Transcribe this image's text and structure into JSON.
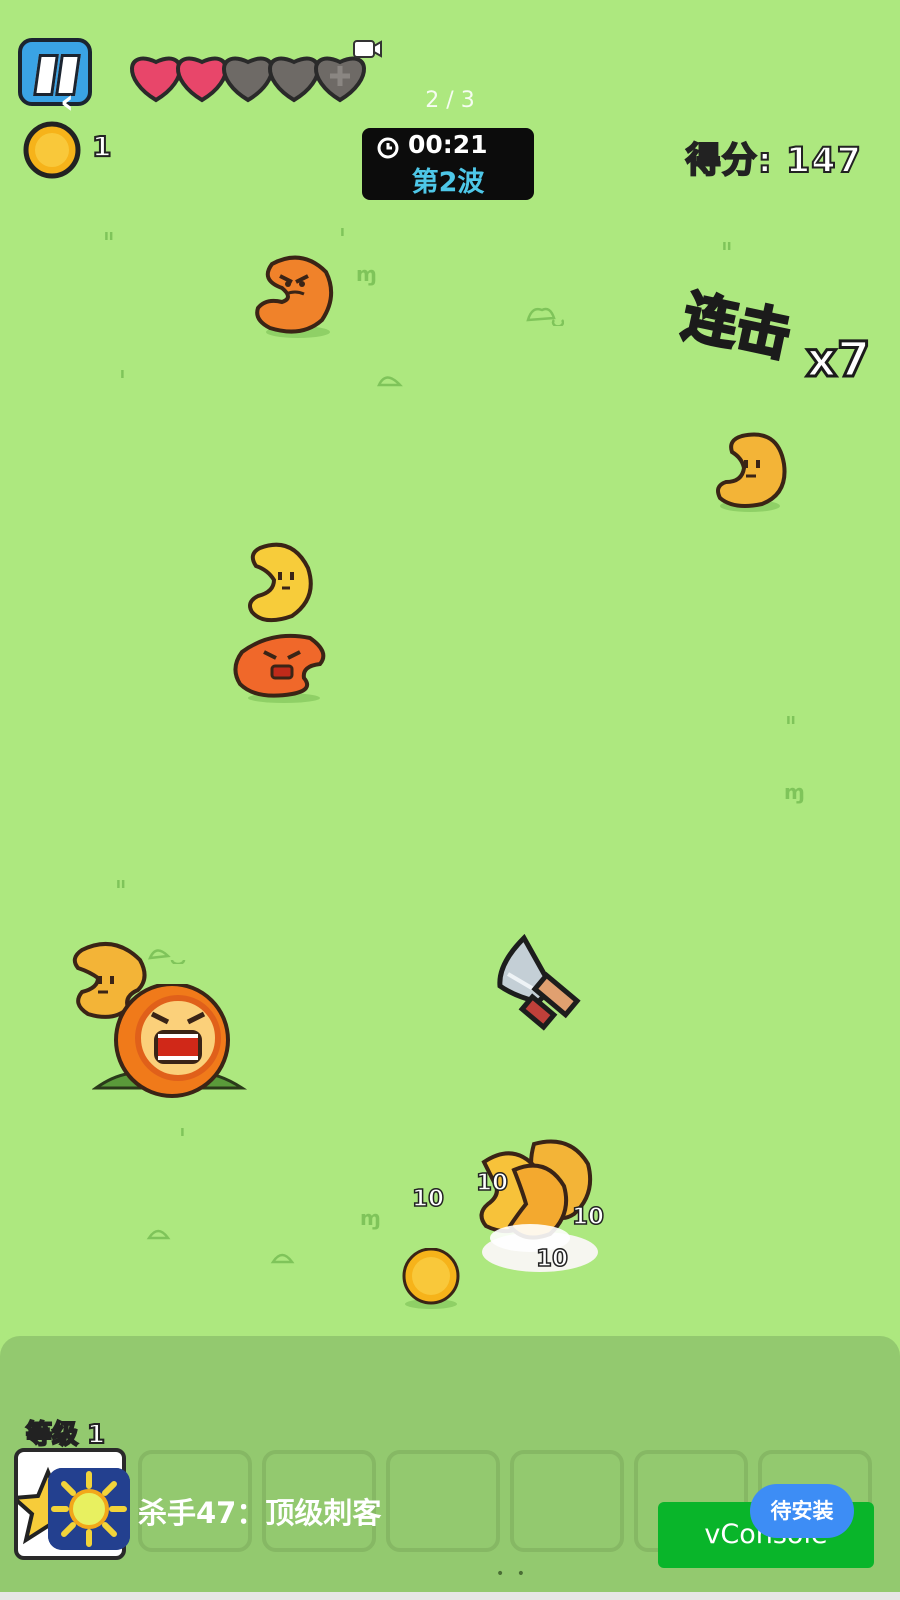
{
  "hud": {
    "page_counter": "2 / 3",
    "coins": "1",
    "timer": "00:21",
    "wave": "第2波",
    "score": "得分: 147",
    "hearts_full": 2,
    "hearts_total": 5
  },
  "combo": {
    "label": "连击",
    "count": "x7"
  },
  "damage_numbers": [
    "10",
    "10",
    "10",
    "10"
  ],
  "bottom": {
    "level_label": "等级 1",
    "ad_title": "杀手47：顶级刺客",
    "vconsole_label": "vConsole",
    "install_badge": "待安装",
    "dots": "• •"
  },
  "colors": {
    "background": "#ade87f",
    "heart_full": "#e8466a",
    "heart_empty": "#6e6a66",
    "timer_wave": "#4ec7e8",
    "combo_label": "#ffe24a",
    "vconsole": "#09b52a",
    "install_badge": "#3d8df5"
  }
}
